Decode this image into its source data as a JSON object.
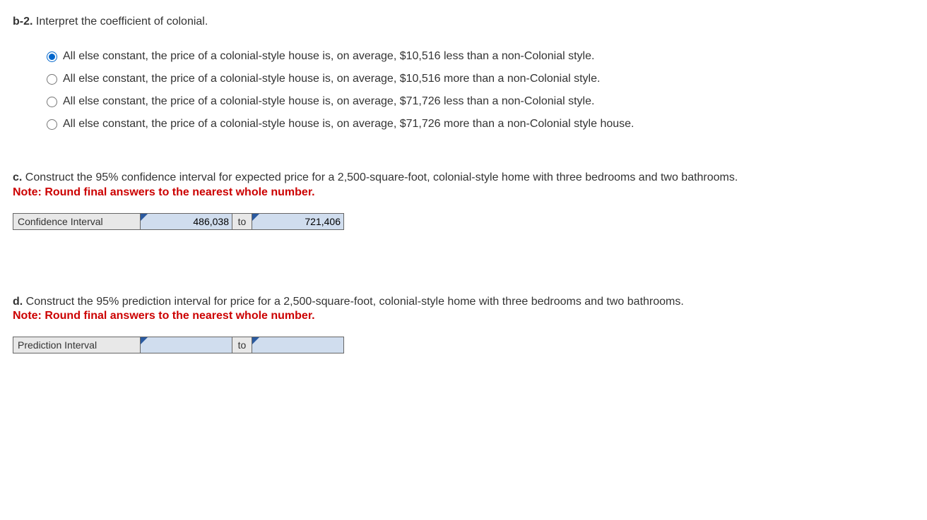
{
  "b2": {
    "label": "b-2.",
    "prompt": " Interpret the coefficient of colonial.",
    "options": [
      "All else constant, the price of a colonial-style house is, on average, $10,516 less than a non-Colonial style.",
      "All else constant, the price of a colonial-style house is, on average, $10,516 more than a non-Colonial style.",
      "All else constant, the price of a colonial-style house is, on average, $71,726 less than a non-Colonial style.",
      "All else constant, the price of a colonial-style house is, on average, $71,726 more than a non-Colonial style house."
    ],
    "selected_index": 0
  },
  "c": {
    "label": "c.",
    "prompt": " Construct the 95% confidence interval for expected price for a 2,500-square-foot, colonial-style home with three bedrooms and two bathrooms.",
    "note": "Note: Round final answers to the nearest whole number.",
    "row_label": "Confidence Interval",
    "lower": "486,038",
    "to": "to",
    "upper": "721,406"
  },
  "d": {
    "label": "d.",
    "prompt": " Construct the 95% prediction interval for price for a 2,500-square-foot, colonial-style home with three bedrooms and two bathrooms.",
    "note": "Note: Round final answers to the nearest whole number.",
    "row_label": "Prediction Interval",
    "lower": "",
    "to": "to",
    "upper": ""
  }
}
